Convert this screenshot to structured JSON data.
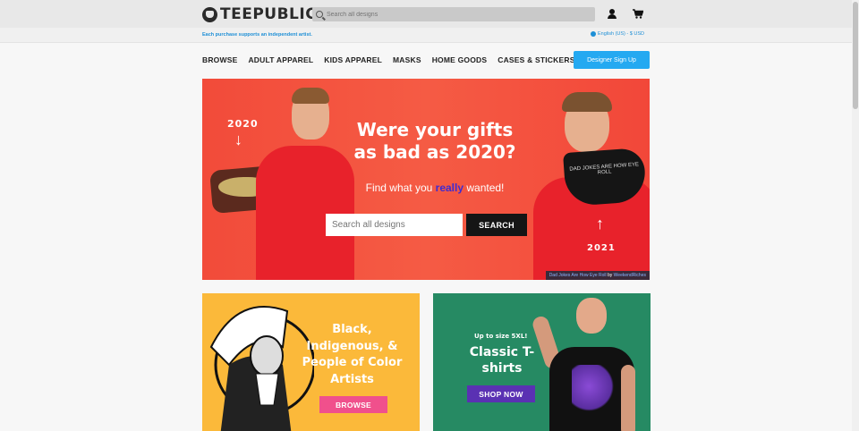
{
  "header": {
    "logo_text": "TEEPUBLIC",
    "search_placeholder": "Search all designs",
    "icons": [
      "user-icon",
      "cart-icon"
    ]
  },
  "subbar": {
    "note": "Each purchase supports an independent artist.",
    "locale": "English (US) - $ USD"
  },
  "nav": {
    "items": [
      "BROWSE",
      "ADULT APPAREL",
      "KIDS APPAREL",
      "MASKS",
      "HOME GOODS",
      "CASES & STICKERS"
    ],
    "signup_label": "Designer Sign Up"
  },
  "hero": {
    "title": "Were your gifts as bad as 2020?",
    "subtitle_prefix": "Find what you ",
    "subtitle_highlight": "really",
    "subtitle_suffix": " wanted!",
    "search_placeholder": "Search all designs",
    "search_button": "SEARCH",
    "label_left": "2020",
    "label_right": "2021",
    "mask_text": "DAD JOKES ARE HOW EYE ROLL",
    "credit_design": "Dad Jokes Are How Eye Roll",
    "credit_by": " by ",
    "credit_artist": "WeekendRiches"
  },
  "cards": {
    "left": {
      "title": "Black, Indigenous, & People of Color Artists",
      "button": "BROWSE",
      "color": "#fbb93a",
      "button_color": "#f0508c"
    },
    "right": {
      "tag": "Up to size 5XL!",
      "title": "Classic T-shirts",
      "button": "SHOP NOW",
      "color": "#268a63",
      "button_color": "#5a31b3"
    }
  },
  "colors": {
    "accent": "#24a9f1",
    "hero_bg": "#f24b3a"
  }
}
